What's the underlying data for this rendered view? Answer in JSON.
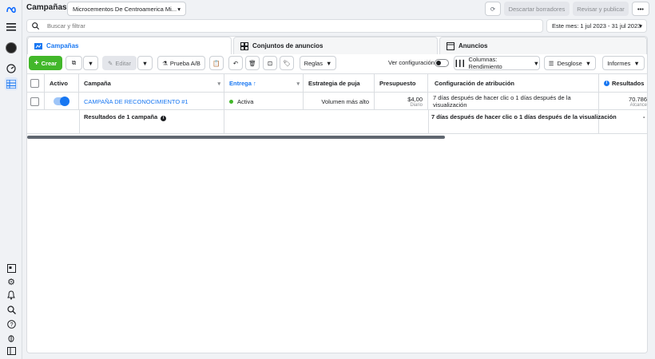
{
  "app": {
    "title": "Campañas",
    "account_selector": "Microcementos De Centroamerica Mi...",
    "discard_drafts": "Descartar borradores",
    "review_publish": "Revisar y publicar",
    "more": "•••"
  },
  "search": {
    "placeholder": "Buscar y filtrar",
    "date_range": "Este mes: 1 jul 2023 - 31 jul 2023"
  },
  "tabs": [
    {
      "label": "Campañas"
    },
    {
      "label": "Conjuntos de anuncios"
    },
    {
      "label": "Anuncios"
    }
  ],
  "toolbar": {
    "create": "Crear",
    "edit": "Editar",
    "ab_test": "Prueba A/B",
    "rules": "Reglas",
    "view_setup": "Ver configuración",
    "columns": "Columnas: Rendimiento",
    "breakdown": "Desglose",
    "reports": "Informes"
  },
  "table": {
    "headers": {
      "active": "Activo",
      "campaign": "Campaña",
      "delivery": "Entrega ↑",
      "bid_strategy": "Estrategia de puja",
      "budget": "Presupuesto",
      "attribution": "Configuración de atribución",
      "results": "Resultados"
    },
    "row": {
      "campaign": "CAMPAÑA DE RECONOCIMIENTO #1",
      "delivery": "Activa",
      "bid_strategy": "Volumen más alto",
      "budget": "$4,00",
      "budget_sub": "Diario",
      "attribution": "7 días después de hacer clic o 1 días después de la visualización",
      "results": "70.786",
      "results_sub": "Alcance"
    },
    "summary": {
      "label": "Resultados de 1 campaña",
      "attribution": "7 días después de hacer clic o 1 días después de la visualización",
      "results": "-"
    }
  },
  "colors": {
    "accent": "#1877f2",
    "active_green": "#42b72a",
    "create_green": "#42b72a"
  },
  "icons": [
    "meta-icon",
    "menu-icon",
    "account-avatar-icon",
    "dashboard-icon",
    "campaigns-grid-icon",
    "pages-icon",
    "settings-icon",
    "notifications-icon",
    "search-icon",
    "help-icon",
    "bug-icon",
    "sidebar-toggle-icon"
  ]
}
